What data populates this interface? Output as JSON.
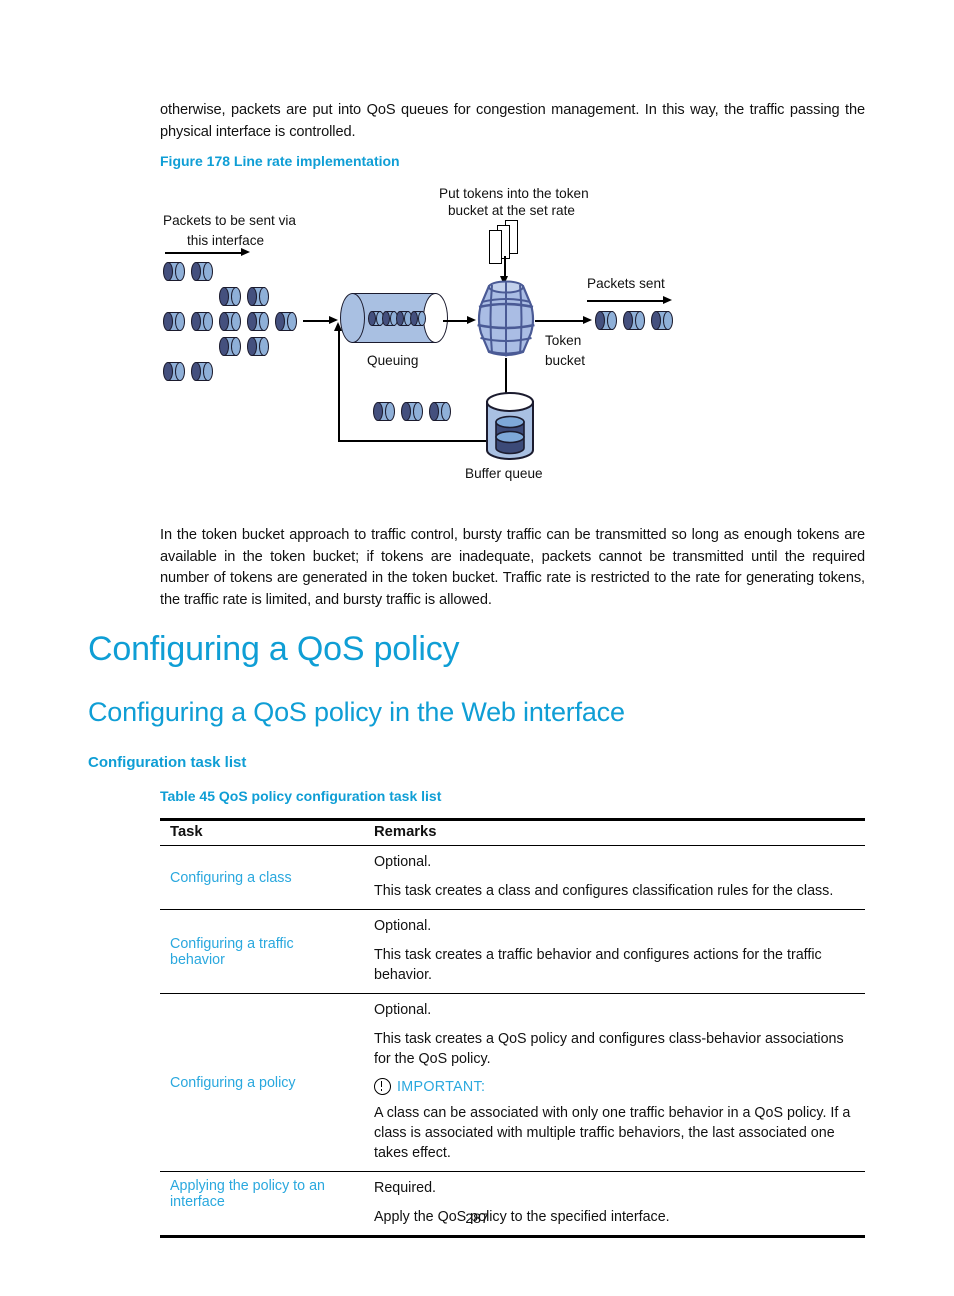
{
  "intro_paragraph": "otherwise, packets are put into QoS queues for congestion management. In this way, the traffic passing the physical interface is controlled.",
  "figure": {
    "caption": "Figure 178 Line rate implementation",
    "labels": {
      "packets_in": "Packets to be sent via",
      "packets_in_2": "this interface",
      "put_tokens_1": "Put tokens into the token",
      "put_tokens_2": "bucket at the set rate",
      "packets_sent": "Packets sent",
      "queuing": "Queuing",
      "token_bucket_1": "Token",
      "token_bucket_2": "bucket",
      "buffer_queue": "Buffer queue"
    },
    "colors": {
      "packet_dark": "#44507e",
      "packet_light": "#8fb0d8",
      "tube_fill": "#a9c0e2",
      "barrel_fill": "#aabde4",
      "barrel_stroke": "#4a5a95",
      "outline": "#1b1b2e"
    }
  },
  "token_paragraph": "In the token bucket approach to traffic control, bursty traffic can be transmitted so long as enough tokens are available in the token bucket; if tokens are inadequate, packets cannot be transmitted until the required number of tokens are generated in the token bucket. Traffic rate is restricted to the rate for generating tokens, the traffic rate is limited, and bursty traffic is allowed.",
  "headings": {
    "h1": "Configuring a QoS policy",
    "h2": "Configuring a QoS policy in the Web interface",
    "h3": "Configuration task list"
  },
  "table": {
    "caption": "Table 45 QoS policy configuration task list",
    "headers": {
      "task": "Task",
      "remarks": "Remarks"
    },
    "rows": [
      {
        "task": "Configuring a class",
        "remark_1": "Optional.",
        "remark_2": "This task creates a class and configures classification rules for the class."
      },
      {
        "task_line_1": "Configuring a traffic",
        "task_line_2": "behavior",
        "remark_1": "Optional.",
        "remark_2": "This task creates a traffic behavior and configures actions for the traffic behavior."
      },
      {
        "task": "Configuring a policy",
        "remark_1": "Optional.",
        "remark_2": "This task creates a QoS policy and configures class-behavior associations for the QoS policy.",
        "note_label": "IMPORTANT:",
        "note_body": "A class can be associated with only one traffic behavior in a QoS policy. If a class is associated with multiple traffic behaviors, the last associated one takes effect."
      },
      {
        "task_line_1": "Applying the policy to an",
        "task_line_2": "interface",
        "remark_1": "Required.",
        "remark_2": "Apply the QoS policy to the specified interface."
      }
    ]
  },
  "page_number": "287",
  "accent_color": "#0f9ed5",
  "link_color": "#2aa8de"
}
